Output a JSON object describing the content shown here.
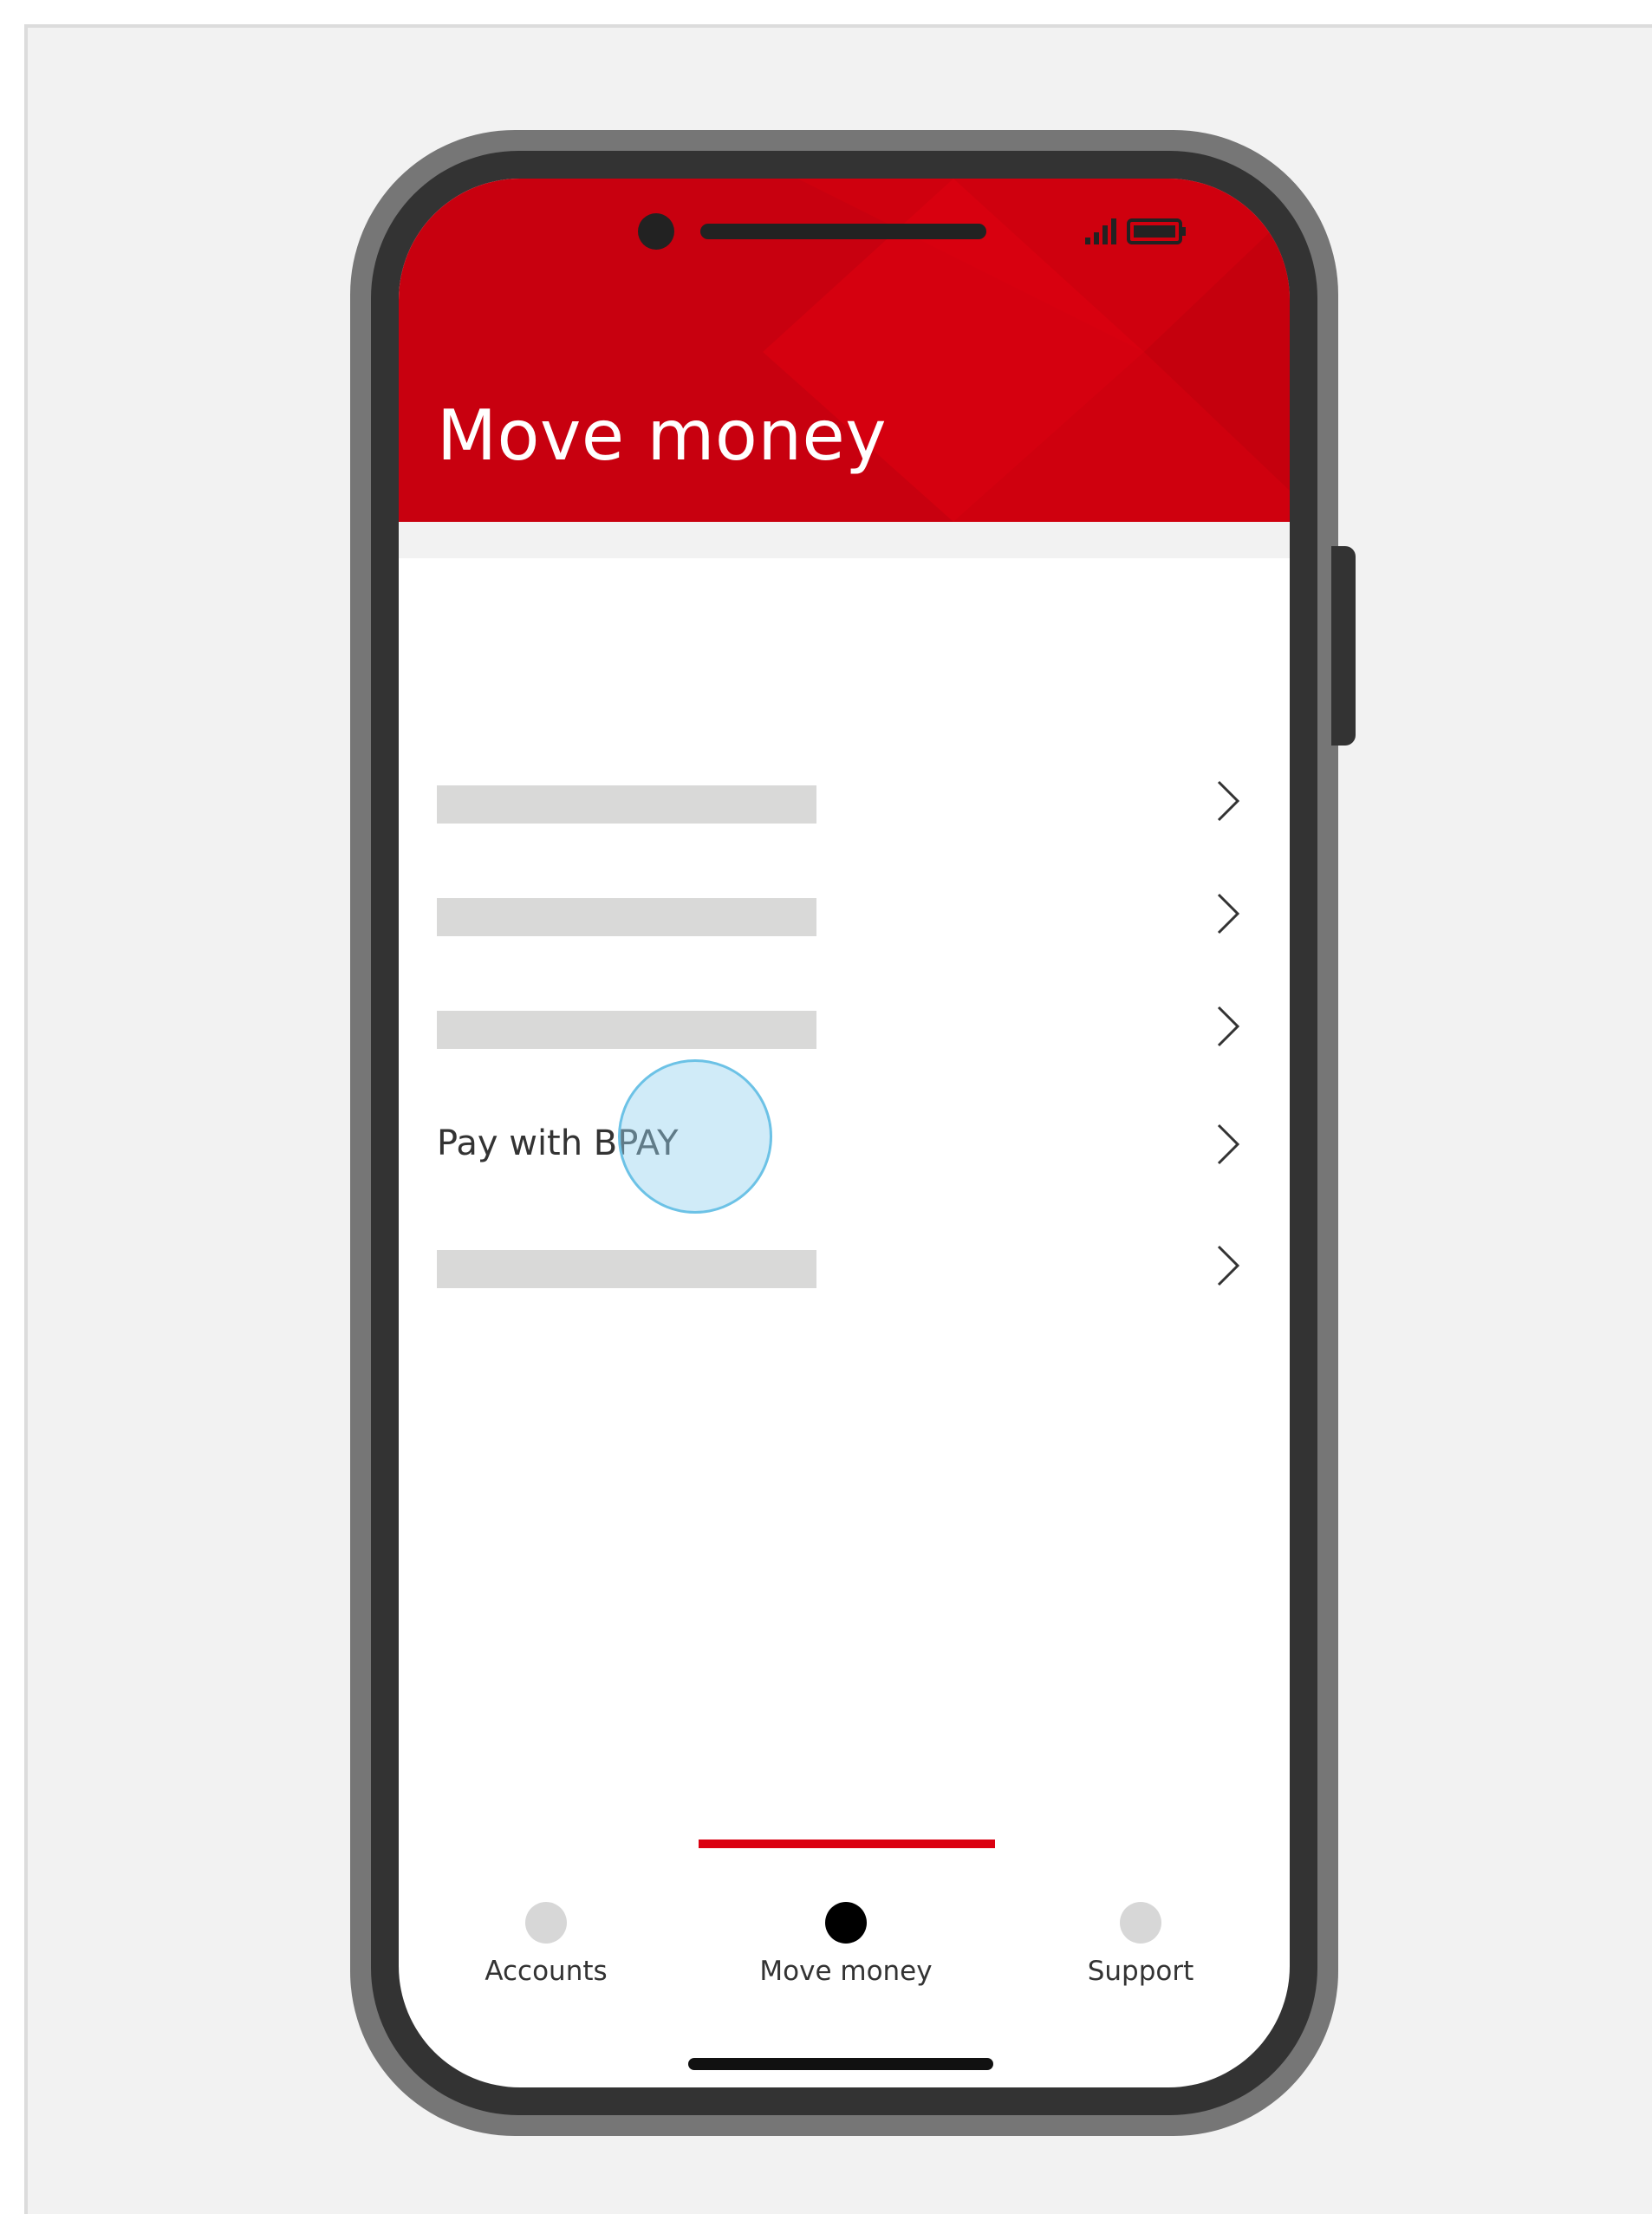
{
  "header": {
    "title": "Move money",
    "color": "#c8000f"
  },
  "status_bar": {
    "icons": [
      "camera-dot",
      "speaker-grille",
      "signal-icon",
      "battery-icon"
    ]
  },
  "menu": {
    "items": [
      {
        "type": "placeholder",
        "label": ""
      },
      {
        "type": "placeholder",
        "label": ""
      },
      {
        "type": "placeholder",
        "label": ""
      },
      {
        "type": "text",
        "label": "Pay with BPAY"
      },
      {
        "type": "placeholder",
        "label": ""
      }
    ],
    "chevron_icon": "chevron-right-icon"
  },
  "bottom_nav": {
    "items": [
      {
        "label": "Accounts",
        "active": false
      },
      {
        "label": "Move money",
        "active": true
      },
      {
        "label": "Support",
        "active": false
      }
    ],
    "accent": "#db0011"
  },
  "touch_indicator": {
    "color": "#6cc2e6"
  }
}
